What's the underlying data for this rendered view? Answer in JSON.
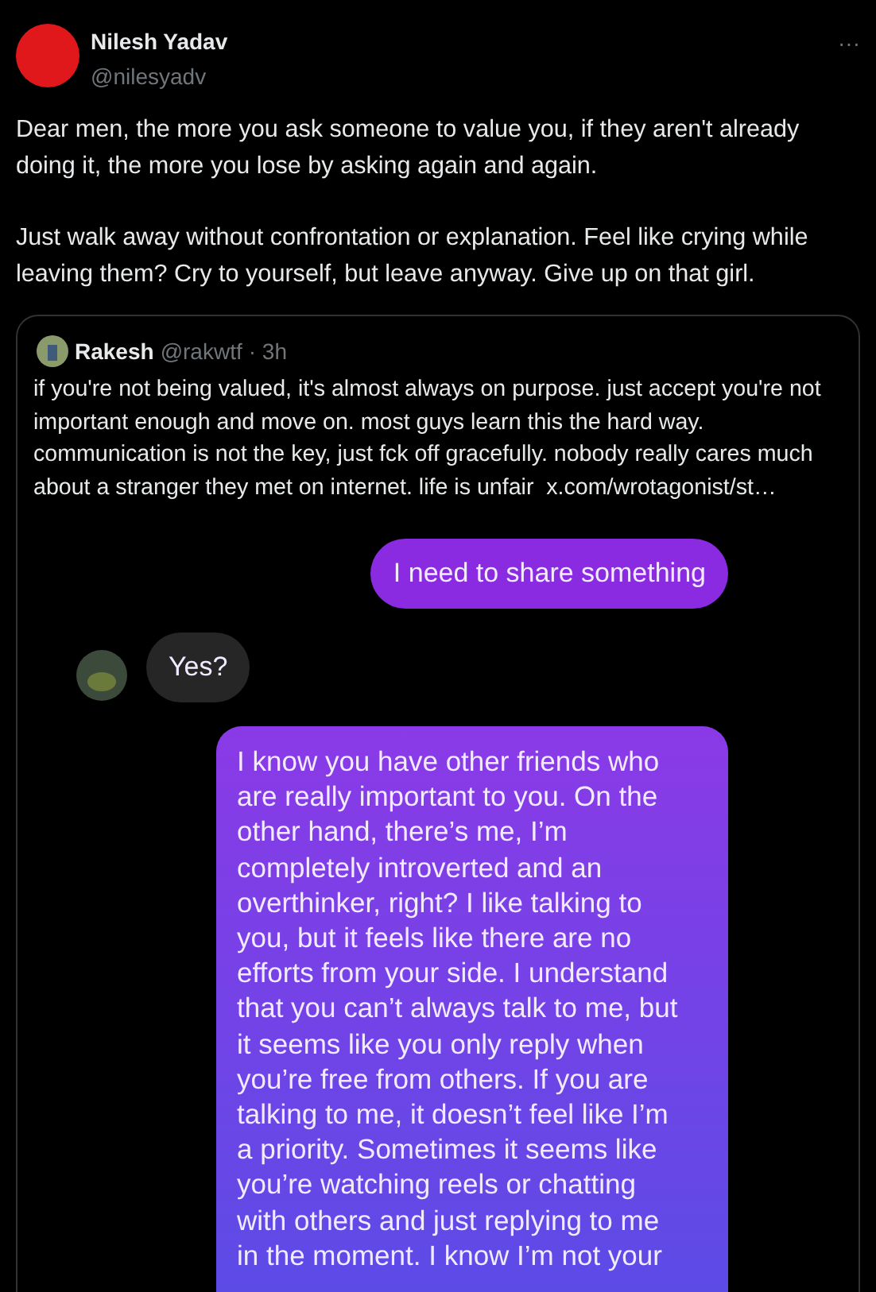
{
  "post": {
    "author": "Nilesh Yadav",
    "handle": "@nilesyadv",
    "more": "···",
    "paragraphs": [
      "Dear men, the more you ask someone to value you, if they aren't already doing it, the more you lose by asking again and again.",
      "Just walk away without confrontation or explanation. Feel like crying while leaving them? Cry to yourself, but leave anyway. Give up on that girl."
    ]
  },
  "quote": {
    "author": "Rakesh",
    "handle": "@rakwtf",
    "time": "· 3h",
    "text": "if you're not being valued, it's almost always on purpose. just accept you're not important enough and move on. most guys learn this the hard way. communication is not the key, just fck off gracefully. nobody really cares much about a stranger they met on internet. life is unfair",
    "link": "x.com/wrotagonist/st…"
  },
  "chat": {
    "messages": [
      {
        "kind": "sent",
        "text": "I need to share something"
      },
      {
        "kind": "received",
        "text": "Yes?"
      },
      {
        "kind": "sent_long",
        "lines": [
          "I know you have other friends who",
          "are really important to you. On the",
          "other hand, there’s me, I’m",
          "completely introverted and an",
          "overthinker, right? I like talking to",
          "you, but it feels like there are no",
          "efforts from your side. I understand",
          "that you can’t always talk to me, but",
          "it seems like you only reply when",
          "you’re free from others. If you are",
          "talking to me, it doesn’t feel like I’m",
          "a priority. Sometimes it seems like",
          "you’re watching reels or chatting",
          "with others and just replying to me",
          "in the moment. I know I’m not your"
        ]
      }
    ]
  }
}
